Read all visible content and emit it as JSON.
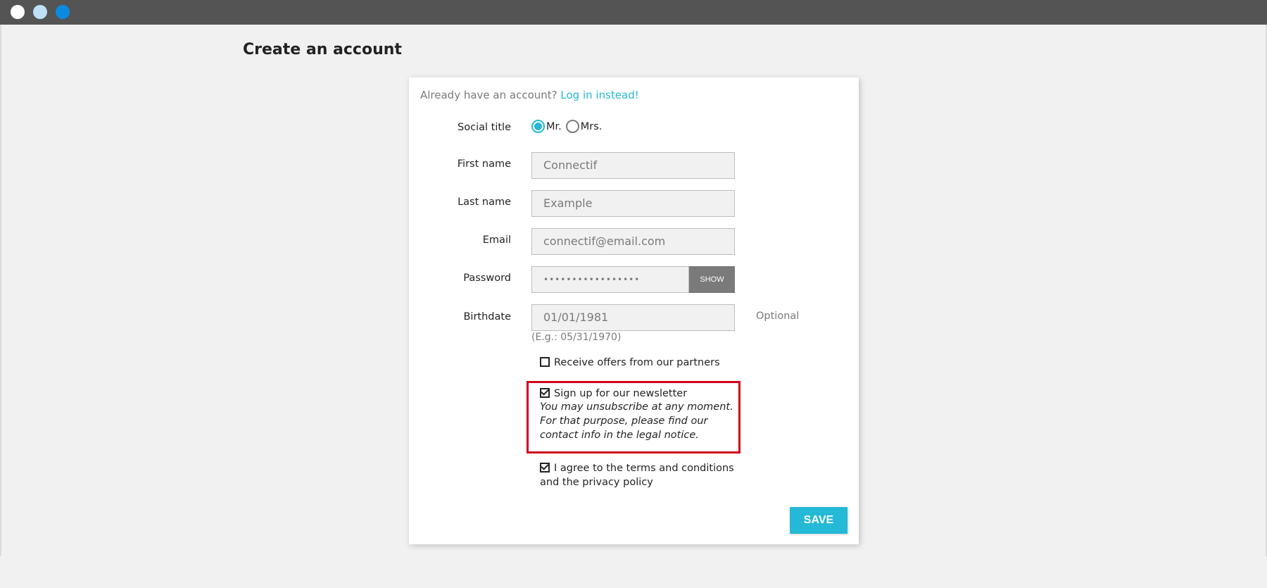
{
  "page": {
    "title": "Create an account"
  },
  "account": {
    "prompt": "Already have an account?",
    "login_link": "Log in instead!"
  },
  "form": {
    "social_title": {
      "label": "Social title",
      "options": [
        "Mr.",
        "Mrs."
      ],
      "selected": "Mr."
    },
    "first_name": {
      "label": "First name",
      "value": "Connectif"
    },
    "last_name": {
      "label": "Last name",
      "value": "Example"
    },
    "email": {
      "label": "Email",
      "value": "connectif@email.com"
    },
    "password": {
      "label": "Password",
      "value": "•••••••••••••••••",
      "show_label": "SHOW"
    },
    "birthdate": {
      "label": "Birthdate",
      "value": "01/01/1981",
      "optional": "Optional",
      "hint": "(E.g.: 05/31/1970)"
    },
    "offers": {
      "label": "Receive offers from our partners",
      "checked": false
    },
    "newsletter": {
      "label": "Sign up for our newsletter",
      "note": "You may unsubscribe at any moment. For that purpose, please find our contact info in the legal notice.",
      "checked": true
    },
    "terms": {
      "label": "I agree to the terms and conditions and the privacy policy",
      "checked": true
    },
    "save_label": "SAVE"
  },
  "colors": {
    "accent": "#24b9d7",
    "highlight": "#d0021b",
    "titlebar": "#545454"
  }
}
